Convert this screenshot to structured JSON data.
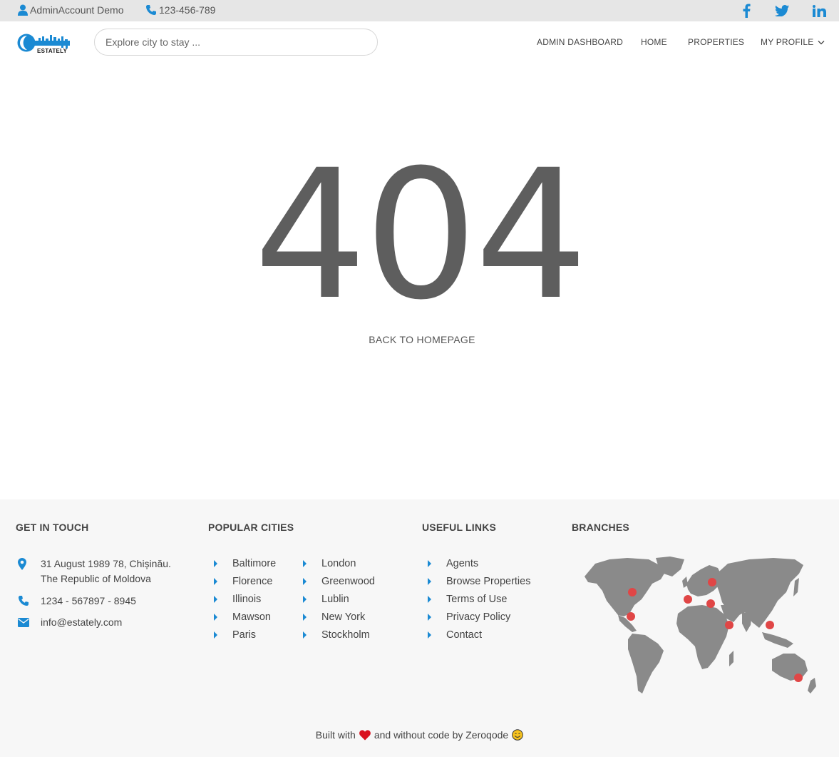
{
  "topbar": {
    "account": "AdminAccount Demo",
    "phone": "123-456-789",
    "socials": [
      "facebook-icon",
      "twitter-icon",
      "linkedin-icon"
    ]
  },
  "header": {
    "logo_text": "ESTATELY",
    "search_placeholder": "Explore city to stay ...",
    "nav": {
      "admin": "ADMIN DASHBOARD",
      "home": "HOME",
      "properties": "PROPERTIES",
      "profile": "MY PROFILE"
    }
  },
  "main": {
    "error_code": "404",
    "back_link": "BACK TO HOMEPAGE"
  },
  "footer": {
    "get_in_touch": {
      "title": "GET IN TOUCH",
      "address_line1": "31 August 1989 78, Chișinău.",
      "address_line2": "The Republic of Moldova",
      "phone": "1234 - 567897 - 8945",
      "email": "info@estately.com"
    },
    "popular_cities": {
      "title": "POPULAR CITIES",
      "col1": [
        "Baltimore",
        "Florence",
        "Illinois",
        "Mawson",
        "Paris"
      ],
      "col2": [
        "London",
        "Greenwood",
        "Lublin",
        "New York",
        "Stockholm"
      ]
    },
    "useful_links": {
      "title": "USEFUL LINKS",
      "items": [
        "Agents",
        "Browse Properties",
        "Terms of Use",
        "Privacy Policy",
        "Contact"
      ]
    },
    "branches": {
      "title": "BRANCHES"
    },
    "credit": {
      "prefix": "Built with",
      "suffix": "and without code by Zeroqode"
    }
  },
  "colors": {
    "accent": "#1b8ad3",
    "marker": "#e04646",
    "map": "#8a8a8a"
  }
}
